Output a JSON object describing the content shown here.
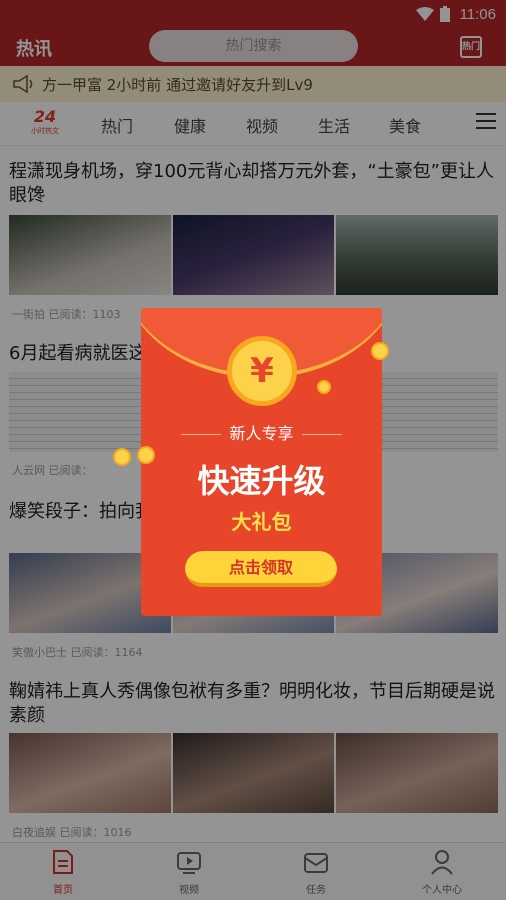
{
  "status_bar": {
    "time": "11:06",
    "icons": [
      "wifi-icon",
      "battery-icon"
    ]
  },
  "header": {
    "title": "热讯",
    "search_placeholder": "热门搜索",
    "right_icon": "hongbao-icon",
    "right_icon_text": "热门"
  },
  "marquee": {
    "icon": "horn-icon",
    "text": "方一甲富 2小时前 通过邀请好友升到Lv9"
  },
  "tabs": {
    "logo_number": "24",
    "logo_sub": "小时热文",
    "items": [
      "热门",
      "健康",
      "视频",
      "生活",
      "美食"
    ],
    "menu_icon": "menu-icon"
  },
  "articles": [
    {
      "title": "程潇现身机场，穿100元背心却搭万元外套，“土豪包”更让人眼馋",
      "source": "一街拍",
      "reads_label": "已阅读：1103"
    },
    {
      "title": "6月起看病就医这",
      "source": "人云网",
      "reads_label": "已阅读："
    },
    {
      "title": "爆笑段子：拍向我                          直接打下床去了!",
      "source": "笑傲小巴士",
      "reads_label": "已阅读：1164"
    },
    {
      "title": "鞠婧祎上真人秀偶像包袱有多重？明明化妆，节目后期硬是说素颜",
      "source": "白夜追娱",
      "reads_label": "已阅读：1016"
    }
  ],
  "popup": {
    "coin_symbol": "¥",
    "subtitle": "新人专享",
    "headline": "快速升级",
    "gift": "大礼包",
    "button": "点击领取"
  },
  "bottom_nav": [
    {
      "label": "首页",
      "icon": "home-doc-icon",
      "active": true
    },
    {
      "label": "视频",
      "icon": "video-icon",
      "active": false
    },
    {
      "label": "任务",
      "icon": "task-envelope-icon",
      "active": false
    },
    {
      "label": "个人中心",
      "icon": "user-icon",
      "active": false
    }
  ],
  "colors": {
    "brand_red": "#b5262c",
    "accent_red": "#d8312a",
    "gold": "#fcd24a"
  }
}
